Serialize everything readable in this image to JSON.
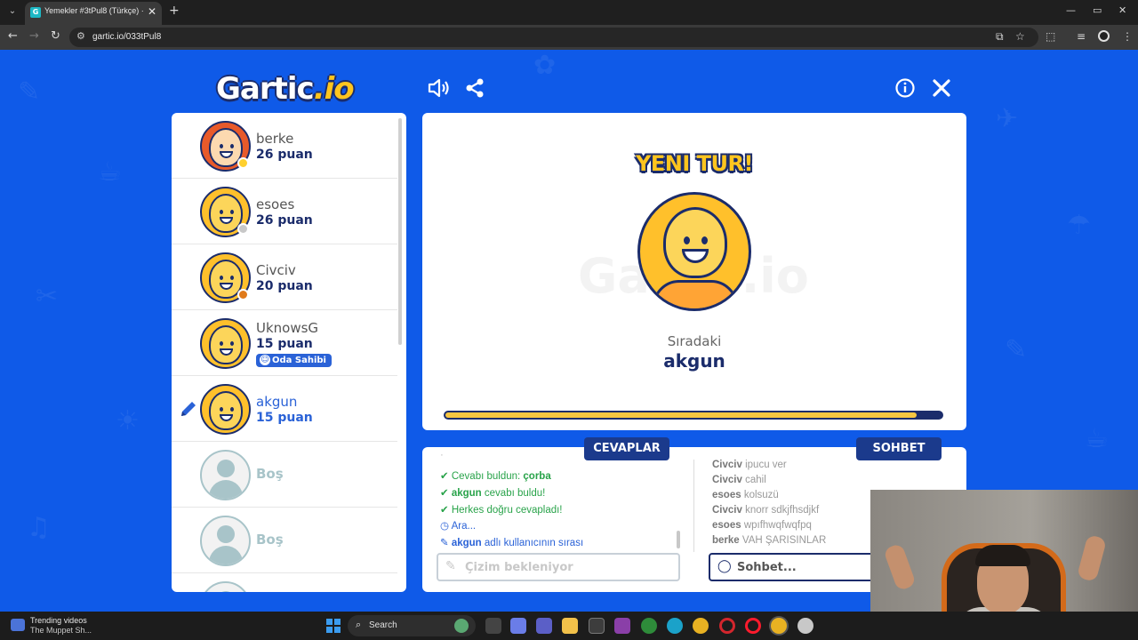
{
  "browser": {
    "tab_title": "Yemekler #3tPul8 (Türkçe) ·",
    "tab_favicon": "G",
    "url": "gartic.io/033tPul8",
    "icons": [
      "tab-list-icon",
      "close-icon",
      "plus-icon",
      "back-icon",
      "forward-icon",
      "reload-icon",
      "site-info-icon",
      "cast-icon",
      "star-icon",
      "extensions-icon",
      "media-icon",
      "profile-icon",
      "more-icon"
    ],
    "window_controls": [
      "minimize-icon",
      "restore-icon",
      "close-icon"
    ]
  },
  "game": {
    "logo_main": "Gartic",
    "logo_suffix": ".io",
    "icons": [
      "sound-icon",
      "share-icon",
      "info-icon",
      "close-icon"
    ],
    "players": [
      {
        "name": "berke",
        "score": "26 puan",
        "status_color": "#ffd02e",
        "avatar": "girl"
      },
      {
        "name": "esoes",
        "score": "26 puan",
        "status_color": "#c8c8c8",
        "avatar": "default"
      },
      {
        "name": "Civciv",
        "score": "20 puan",
        "status_color": "#e07a1a",
        "avatar": "default"
      },
      {
        "name": "UknowsG",
        "score": "15 puan",
        "badge": "Oda Sahibi",
        "avatar": "default"
      },
      {
        "name": "akgun",
        "score": "15 puan",
        "drawing": true,
        "avatar": "default"
      },
      {
        "name": "Boş",
        "empty": true
      },
      {
        "name": "Boş",
        "empty": true
      }
    ],
    "main": {
      "heading": "YENI TUR!",
      "watermark": "Gartic.io",
      "next_label": "Sıradaki",
      "next_player": "akgun",
      "progress": 0.95
    },
    "answers": {
      "tab_label": "CEVAPLAR",
      "feed": [
        {
          "icon": "check-icon",
          "prefix": "Cevabı buldun: ",
          "bold": "çorba",
          "color": "green"
        },
        {
          "icon": "check-icon",
          "bold": "akgun",
          "suffix": " cevabı buldu!",
          "color": "green"
        },
        {
          "icon": "check-icon",
          "prefix": "Herkes doğru cevapladı!",
          "color": "green"
        },
        {
          "icon": "clock-icon",
          "prefix": "Ara...",
          "color": "blue"
        },
        {
          "icon": "pencil-icon",
          "bold": "akgun",
          "suffix": " adlı kullanıcının sırası",
          "color": "blue"
        }
      ],
      "input_placeholder": "Çizim bekleniyor"
    },
    "chat": {
      "tab_label": "SOHBET",
      "messages": [
        {
          "user": "Civciv",
          "text": "ipucu ver"
        },
        {
          "user": "Civciv",
          "text": "cahil"
        },
        {
          "user": "esoes",
          "text": "kolsuzü"
        },
        {
          "user": "Civciv",
          "text": "knorr sdkjfhsdjkf"
        },
        {
          "user": "esoes",
          "text": "wpıfhwqfwqfpq"
        },
        {
          "user": "berke",
          "text": "VAH ŞARISINLAR"
        }
      ],
      "input_placeholder": "Sohbet..."
    }
  },
  "taskbar": {
    "news_title": "Trending videos",
    "news_subtitle": "The Muppet Sh...",
    "search_label": "Search",
    "apps": [
      "task-view-icon",
      "copilot-icon",
      "teams-icon",
      "file-explorer-icon",
      "store-icon",
      "app-icon",
      "xbox-icon",
      "edge-icon",
      "chrome-icon",
      "opera-icon",
      "opera-gx-icon",
      "chrome-active-icon",
      "steam-icon"
    ]
  }
}
